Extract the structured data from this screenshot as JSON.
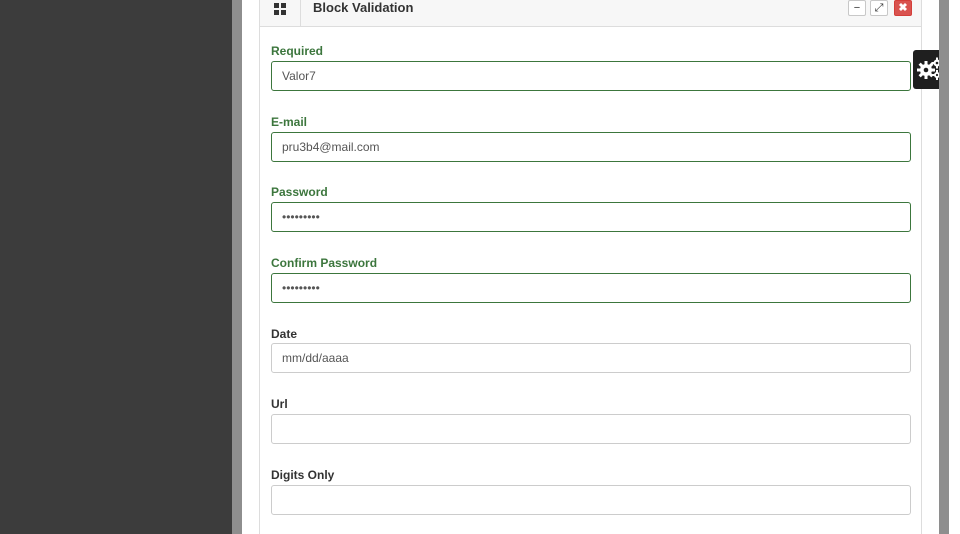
{
  "panel": {
    "title": "Block Validation",
    "controls": {
      "minimize": "−",
      "maximize": "⤢",
      "close": "✖"
    },
    "icons": {
      "header": "grid-icon",
      "settings": "gears-icon"
    }
  },
  "form": {
    "required": {
      "label": "Required",
      "value": "Valor7",
      "state": "valid"
    },
    "email": {
      "label": "E-mail",
      "value": "pru3b4@mail.com",
      "state": "valid"
    },
    "password": {
      "label": "Password",
      "value": "•••••••••",
      "state": "valid"
    },
    "confirm_password": {
      "label": "Confirm Password",
      "value": "•••••••••",
      "state": "valid"
    },
    "date": {
      "label": "Date",
      "value": "mm/dd/aaaa"
    },
    "url": {
      "label": "Url",
      "value": ""
    },
    "digits": {
      "label": "Digits Only",
      "value": ""
    }
  },
  "colors": {
    "valid": "#3c763d",
    "sidebar": "#3c3c3c",
    "close_button": "#d9534f"
  }
}
